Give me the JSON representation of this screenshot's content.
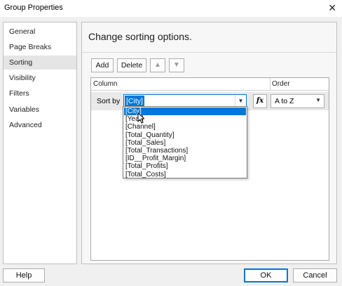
{
  "window": {
    "title": "Group Properties",
    "close_glyph": "✕"
  },
  "nav": {
    "items": [
      {
        "label": "General"
      },
      {
        "label": "Page Breaks"
      },
      {
        "label": "Sorting"
      },
      {
        "label": "Visibility"
      },
      {
        "label": "Filters"
      },
      {
        "label": "Variables"
      },
      {
        "label": "Advanced"
      }
    ],
    "selected": "Sorting"
  },
  "panel": {
    "heading": "Change sorting options.",
    "toolbar": {
      "add_label": "Add",
      "delete_label": "Delete",
      "move_up_icon": "▲",
      "move_down_icon": "▼"
    },
    "grid": {
      "column_header": "Column",
      "order_header": "Order",
      "rows": [
        {
          "label": "Sort by",
          "value": "[City]",
          "order": "A to Z"
        }
      ]
    },
    "fx_label": "fx",
    "dropdown": {
      "options": [
        "[City]",
        "[Year]",
        "[Channel]",
        "[Total_Quantity]",
        "[Total_Sales]",
        "[Total_Transactions]",
        "[ID__Profit_Margin]",
        "[Total_Profits]",
        "[Total_Costs]"
      ],
      "selected": "[City]"
    }
  },
  "footer": {
    "help_label": "Help",
    "ok_label": "OK",
    "cancel_label": "Cancel"
  },
  "colors": {
    "accent": "#0078d7",
    "selected_nav": "#e5e5e5",
    "background": "#f0f0f0"
  }
}
